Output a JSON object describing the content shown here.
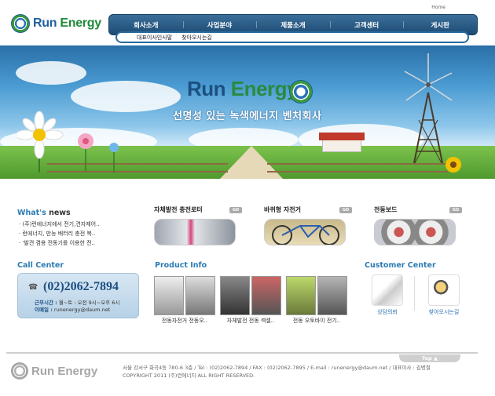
{
  "header": {
    "logo_text_run": "Run",
    "logo_text_energy": "Energy",
    "home": "Home"
  },
  "gnb": [
    "회사소개",
    "사업분야",
    "제품소개",
    "고객센터",
    "게시판"
  ],
  "lnb": [
    "대표이사인사말",
    "찾아오시는길"
  ],
  "banner": {
    "title_run": "Run",
    "title_energy": "Energy",
    "subtitle": "선명성 있는 녹색에너지 벤처회사"
  },
  "news": {
    "title_a": "What's",
    "title_b": "news",
    "items": [
      "· (주)런에너지에서 전기,견자제어..",
      "· 런에너지, 만능 배터리 충전 복..",
      "· '발견 겸용 전동기를 이용한 전.."
    ]
  },
  "products": [
    {
      "title": "자체발전 충전로터",
      "go": "GO"
    },
    {
      "title": "바퀴형 자전거",
      "go": "GO"
    },
    {
      "title": "전동보드",
      "go": "GO"
    }
  ],
  "call_center": {
    "title": "Call Center",
    "phone": "(02)2062-7894",
    "hours_label": "근무시간 :",
    "hours": "월~토 : 오전 9시~오후 6시",
    "email_label": "이메일 :",
    "email": "runenergy@daum.net"
  },
  "product_info": {
    "title": "Product Info",
    "items": [
      {
        "caption": "전동자전거 전동오.."
      },
      {
        "caption": "자체발전 전동 섹셀.."
      },
      {
        "caption": "전동 오토바이 전기.."
      }
    ]
  },
  "customer_center": {
    "title": "Customer Center",
    "items": [
      {
        "label": "상담의뢰"
      },
      {
        "label": "찾아오시는길"
      }
    ]
  },
  "footer": {
    "top": "Top ▲",
    "logo_text": "Run Energy",
    "address": "서울 강서구 화곡4동 780-6 3층 / Tel : (02)2062-7894 / FAX : (02)2062-7895 / E-mail : runenergy@daum.net / 대표이사 : 김병철",
    "copyright": "COPYRIGHT 2011 (주)런에너지 ALL RIGHT RESERVED."
  },
  "colors": {
    "brand_blue": "#1f5f9f",
    "brand_green": "#1f8a3a",
    "nav": "#1d4b75"
  }
}
